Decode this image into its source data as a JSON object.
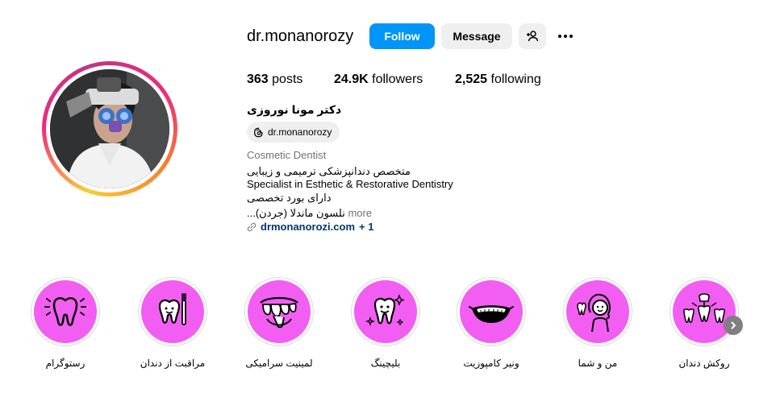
{
  "profile": {
    "username": "dr.monanorozy",
    "follow_label": "Follow",
    "message_label": "Message",
    "stats": {
      "posts_count": "363",
      "posts_label": "posts",
      "followers_count": "24.9K",
      "followers_label": "followers",
      "following_count": "2,525",
      "following_label": "following"
    },
    "full_name": "دکتر مونا نوروزی",
    "threads_handle": "dr.monanorozy",
    "category": "Cosmetic Dentist",
    "bio_lines": [
      "متخصص دندانپزشکی ترمیمی و زیبایی",
      "Specialist in Esthetic & Restorative Dentistry",
      "دارای بورد تخصصی",
      "نلسون ماندلا (جردن)..."
    ],
    "more_label": " more",
    "link_text": "drmonanorozi.com",
    "link_extra": "+ 1"
  },
  "highlights": [
    {
      "label": "رستوگرام",
      "icon": "tooth-sparkle-icon"
    },
    {
      "label": "مراقبت از دندان",
      "icon": "tooth-toothbrush-icon"
    },
    {
      "label": "لمینیت سرامیکی",
      "icon": "veneer-teeth-icon"
    },
    {
      "label": "بلیچینگ",
      "icon": "smiling-tooth-icon"
    },
    {
      "label": "ونیر کامپوزیت",
      "icon": "smile-teeth-icon"
    },
    {
      "label": "من و شما",
      "icon": "woman-tooth-icon"
    },
    {
      "label": "روکش دندان",
      "icon": "dental-crown-icon"
    }
  ],
  "colors": {
    "follow_button": "#0095f6",
    "secondary_button": "#efefef",
    "highlight_fill": "#f25ef2",
    "link": "#00376b",
    "muted_text": "#737373"
  }
}
